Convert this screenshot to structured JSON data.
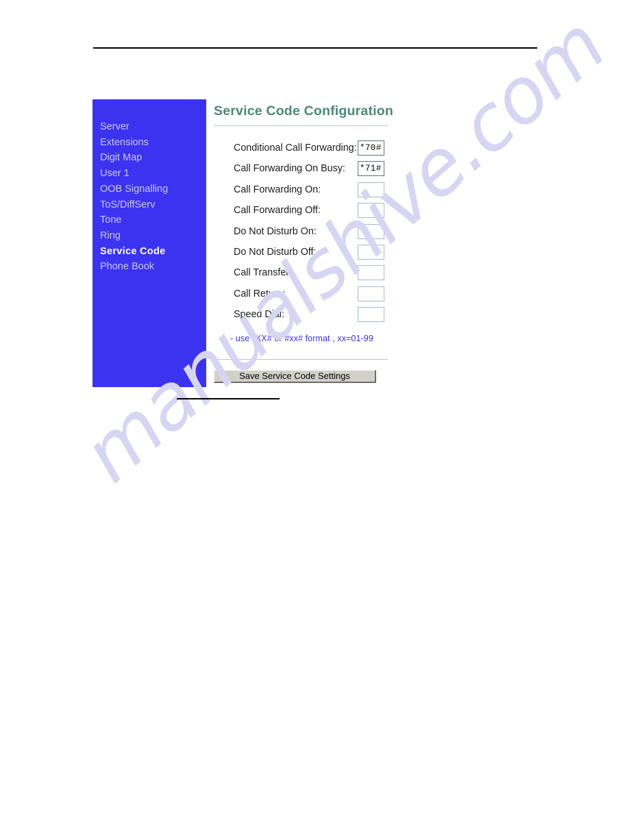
{
  "document": {
    "background": "#ffffff",
    "top_rule": true,
    "bottom_rule": true
  },
  "watermark": {
    "text": "manualshive.com",
    "color": "#d6d6f2"
  },
  "screenshot": {
    "sidebar": {
      "background": "#3c33f0",
      "items": [
        {
          "label": "Server",
          "active": false
        },
        {
          "label": "Extensions",
          "active": false
        },
        {
          "label": "Digit Map",
          "active": false
        },
        {
          "label": "User 1",
          "active": false
        },
        {
          "label": "OOB Signalling",
          "active": false
        },
        {
          "label": "ToS/DiffServ",
          "active": false
        },
        {
          "label": "Tone",
          "active": false
        },
        {
          "label": "Ring",
          "active": false
        },
        {
          "label": "Service Code",
          "active": true
        },
        {
          "label": "Phone Book",
          "active": false
        }
      ]
    },
    "content": {
      "title": "Service Code Configuration",
      "title_color": "#4d8878",
      "fields": [
        {
          "label": "Conditional Call Forwarding:",
          "value": "*70#",
          "placeholder": ""
        },
        {
          "label": "Call Forwarding On Busy:",
          "value": "*71#",
          "placeholder": ""
        },
        {
          "label": "Call Forwarding On:",
          "value": "",
          "placeholder": ""
        },
        {
          "label": "Call Forwarding Off:",
          "value": "",
          "placeholder": ""
        },
        {
          "label": "Do Not Disturb On:",
          "value": "",
          "placeholder": ""
        },
        {
          "label": "Do Not Disturb Off:",
          "value": "",
          "placeholder": ""
        },
        {
          "label": "Call Transfer:",
          "value": "",
          "placeholder": ""
        },
        {
          "label": "Call Return:",
          "value": "",
          "placeholder": ""
        },
        {
          "label": "Speed Dial:",
          "value": "",
          "placeholder": ""
        }
      ],
      "hint": "- use *XX# or #xx# format , xx=01-99",
      "hint_color": "#3c33d8",
      "save_label": "Save Service Code Settings"
    }
  }
}
